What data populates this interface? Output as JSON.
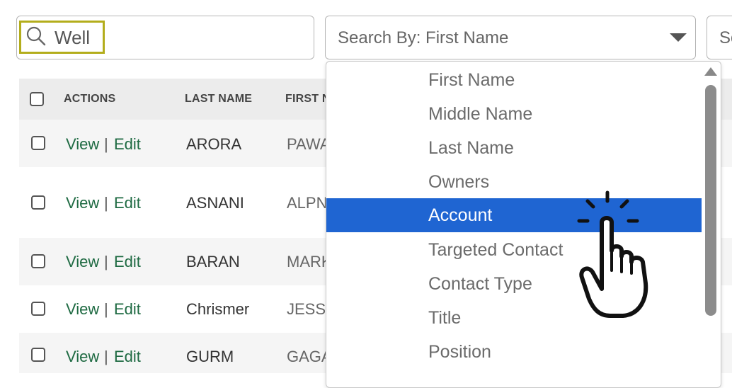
{
  "search": {
    "value": "Well"
  },
  "search_by": {
    "label": "Search By: First Name"
  },
  "third_field": {
    "label": "Sc"
  },
  "table": {
    "headers": {
      "actions": "ACTIONS",
      "last_name": "LAST NAME",
      "first_name": "FIRST NA"
    },
    "rows": [
      {
        "view": "View",
        "sep": "|",
        "edit": "Edit",
        "last": "ARORA",
        "first": "PAWA"
      },
      {
        "view": "View",
        "sep": "|",
        "edit": "Edit",
        "last": "ASNANI",
        "first": "ALPNA"
      },
      {
        "view": "View",
        "sep": "|",
        "edit": "Edit",
        "last": "BARAN",
        "first": "MARK"
      },
      {
        "view": "View",
        "sep": "|",
        "edit": "Edit",
        "last": "Chrismer",
        "first": "JESSIC"
      },
      {
        "view": "View",
        "sep": "|",
        "edit": "Edit",
        "last": "GURM",
        "first": "GAGA"
      }
    ]
  },
  "dropdown": {
    "options": [
      "First Name",
      "Middle Name",
      "Last Name",
      "Owners",
      "Account",
      "Targeted Contact",
      "Contact Type",
      "Title",
      "Position"
    ],
    "selected": "Account"
  },
  "colors": {
    "selected_bg": "#1f65d2",
    "link": "#1e6a42",
    "highlight_border": "#b3ad1c"
  }
}
